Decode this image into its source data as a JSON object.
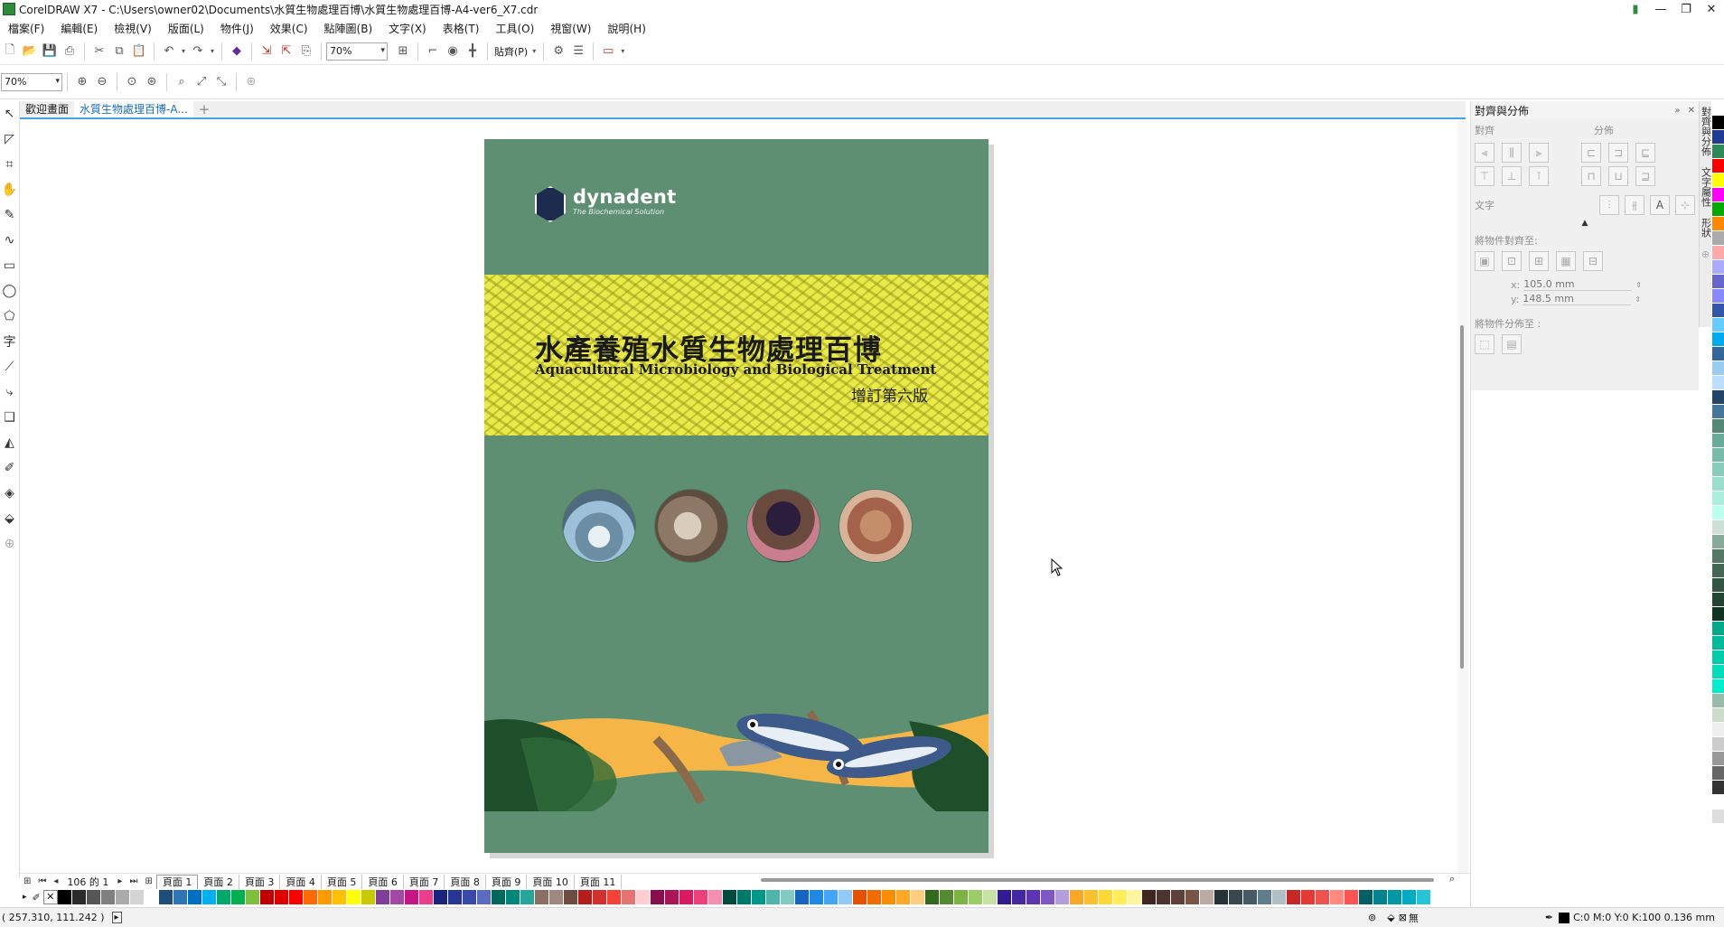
{
  "window": {
    "title": "CorelDRAW X7 - C:\\Users\\owner02\\Documents\\水質生物處理百博\\水質生物處理百博-A4-ver6_X7.cdr",
    "controls": [
      "—",
      "❐",
      "✕"
    ]
  },
  "menu": [
    "檔案(F)",
    "編輯(E)",
    "檢視(V)",
    "版面(L)",
    "物件(J)",
    "效果(C)",
    "點陣圖(B)",
    "文字(X)",
    "表格(T)",
    "工具(O)",
    "視窗(W)",
    "說明(H)"
  ],
  "toolbar": {
    "zoom_value": "70%",
    "snap_label": "貼齊(P)"
  },
  "propbar": {
    "zoom_value": "70%"
  },
  "doc_tabs": [
    {
      "label": "歡迎畫面"
    },
    {
      "label": "水質生物處理百博-A..."
    },
    {
      "label": "+"
    }
  ],
  "cover": {
    "logo_text": "dynadent",
    "logo_sub": "The Biochemical Solution",
    "title": "水產養殖水質生物處理百博",
    "subtitle": "Aquacultural Microbiology and Biological Treatment",
    "edition": "增訂第六版"
  },
  "page_nav": {
    "counter": "106 的 1",
    "tabs": [
      "頁面 1",
      "頁面 2",
      "頁面 3",
      "頁面 4",
      "頁面 5",
      "頁面 6",
      "頁面 7",
      "頁面 8",
      "頁面 9",
      "頁面 10",
      "頁面 11"
    ]
  },
  "right_panel": {
    "title": "對齊與分佈",
    "align_label": "對齊",
    "distribute_label": "分佈",
    "text_label": "文字",
    "align_to_label": "將物件對齊至:",
    "x_label": "x:",
    "x_value": "105.0 mm",
    "y_label": "y:",
    "y_value": "148.5 mm",
    "distribute_to_label": "將物件分佈至 :",
    "side_tabs": [
      "對齊與分佈",
      "文字屬性",
      "形狀"
    ]
  },
  "status": {
    "coords": "( 257.310, 111.242 )",
    "fill_info": "C:0 M:0 Y:0 K:100  0.136 mm",
    "none_label": "無"
  },
  "palette_colors": [
    "#000000",
    "#2b2b2b",
    "#565656",
    "#808080",
    "#aaaaaa",
    "#d4d4d4",
    "#ffffff",
    "#1f4e79",
    "#2e75b6",
    "#0070c0",
    "#00b0f0",
    "#00a86b",
    "#00b050",
    "#7fbf3f",
    "#c00000",
    "#e00000",
    "#ff0000",
    "#ff6a00",
    "#ff9900",
    "#ffc000",
    "#ffff00",
    "#c9c900",
    "#7f3f98",
    "#a349a4",
    "#c71585",
    "#e83e8c",
    "#1a237e",
    "#283593",
    "#3949ab",
    "#5c6bc0",
    "#00695c",
    "#00897b",
    "#26a69a",
    "#8d6e63",
    "#a1887f",
    "#6d4c41",
    "#b71c1c",
    "#d32f2f",
    "#f44336",
    "#e57373",
    "#ffcdd2",
    "#880e4f",
    "#ad1457",
    "#d81b60",
    "#ec407a",
    "#f48fb1",
    "#004d40",
    "#00796b",
    "#009688",
    "#4db6ac",
    "#80cbc4",
    "#1565c0",
    "#1e88e5",
    "#42a5f5",
    "#90caf9",
    "#e65100",
    "#ef6c00",
    "#fb8c00",
    "#ffa726",
    "#ffcc80",
    "#33691e",
    "#558b2f",
    "#7cb342",
    "#9ccc65",
    "#c5e1a5",
    "#311b92",
    "#4527a0",
    "#5e35b1",
    "#7e57c2",
    "#b39ddb",
    "#f9a825",
    "#fbc02d",
    "#fdd835",
    "#ffee58",
    "#fff59d",
    "#3e2723",
    "#4e342e",
    "#5d4037",
    "#795548",
    "#bcaaa4",
    "#263238",
    "#37474f",
    "#455a64",
    "#607d8b",
    "#b0bec5",
    "#c62828",
    "#e53935",
    "#ef5350",
    "#ff8a80",
    "#ff5252",
    "#006064",
    "#00838f",
    "#0097a7",
    "#00acc1",
    "#26c6da"
  ],
  "vpalette_colors": [
    "#ffffff",
    "#000000",
    "#1f3a93",
    "#2e8b57",
    "#ff0000",
    "#ffff00",
    "#ff00ff",
    "#00aa00",
    "#ff8800",
    "#aaaaaa",
    "#ffaaaa",
    "#aaaaff",
    "#6666cc",
    "#8888ff",
    "#3355aa",
    "#66ccff",
    "#00aaee",
    "#336699",
    "#99ccee",
    "#bbddff",
    "#224466",
    "#447799",
    "#558877",
    "#66aa99",
    "#77bbaa",
    "#88ccbb",
    "#99ddcc",
    "#aaeedd",
    "#bbffee",
    "#cce0d8",
    "#88aa99",
    "#557766",
    "#446655",
    "#335544",
    "#224433",
    "#113322",
    "#00aa88",
    "#00bb99",
    "#00ccaa",
    "#00ddbb",
    "#00eecc",
    "#99bbaa",
    "#ccddcc",
    "#eeeeee",
    "#cccccc",
    "#999999",
    "#666666",
    "#333333",
    "#ffffff",
    "#dddddd"
  ]
}
